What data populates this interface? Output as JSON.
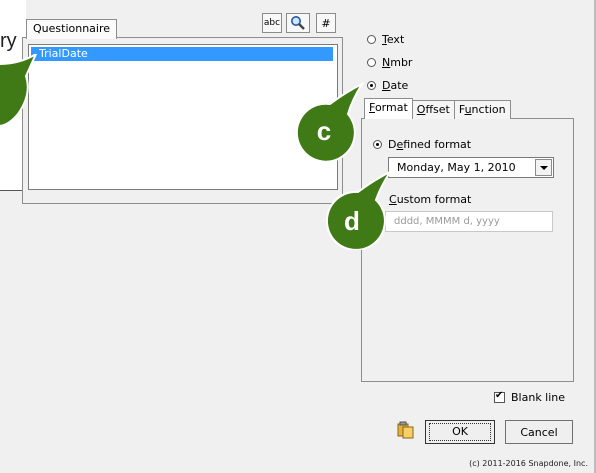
{
  "behind": {
    "text1": "ry",
    "text2": "c"
  },
  "questionnaire": {
    "tab_label": "Questionnaire",
    "items": [
      "TrialDate"
    ],
    "tool_abc": "abc",
    "tool_search_icon": "search-icon",
    "tool_hash": "#"
  },
  "type_options": {
    "text": "Text",
    "nmbr": "Nmbr",
    "date": "Date",
    "selected": "Date"
  },
  "format_tabs": {
    "format": "Format",
    "offset": "Offset",
    "function": "Function",
    "active": "Format"
  },
  "format": {
    "defined_label": "Defined format",
    "defined_value": "Monday, May 1, 2010",
    "custom_label": "Custom format",
    "custom_placeholder": "dddd, MMMM d, yyyy"
  },
  "callouts": [
    "c",
    "d"
  ],
  "blank_line_label": "Blank line",
  "ok_label": "OK",
  "cancel_label": "Cancel",
  "copyright": "(c) 2011-2016 Snapdone, Inc.",
  "colors": {
    "selection": "#3399ff",
    "callout": "#3f7a16"
  }
}
